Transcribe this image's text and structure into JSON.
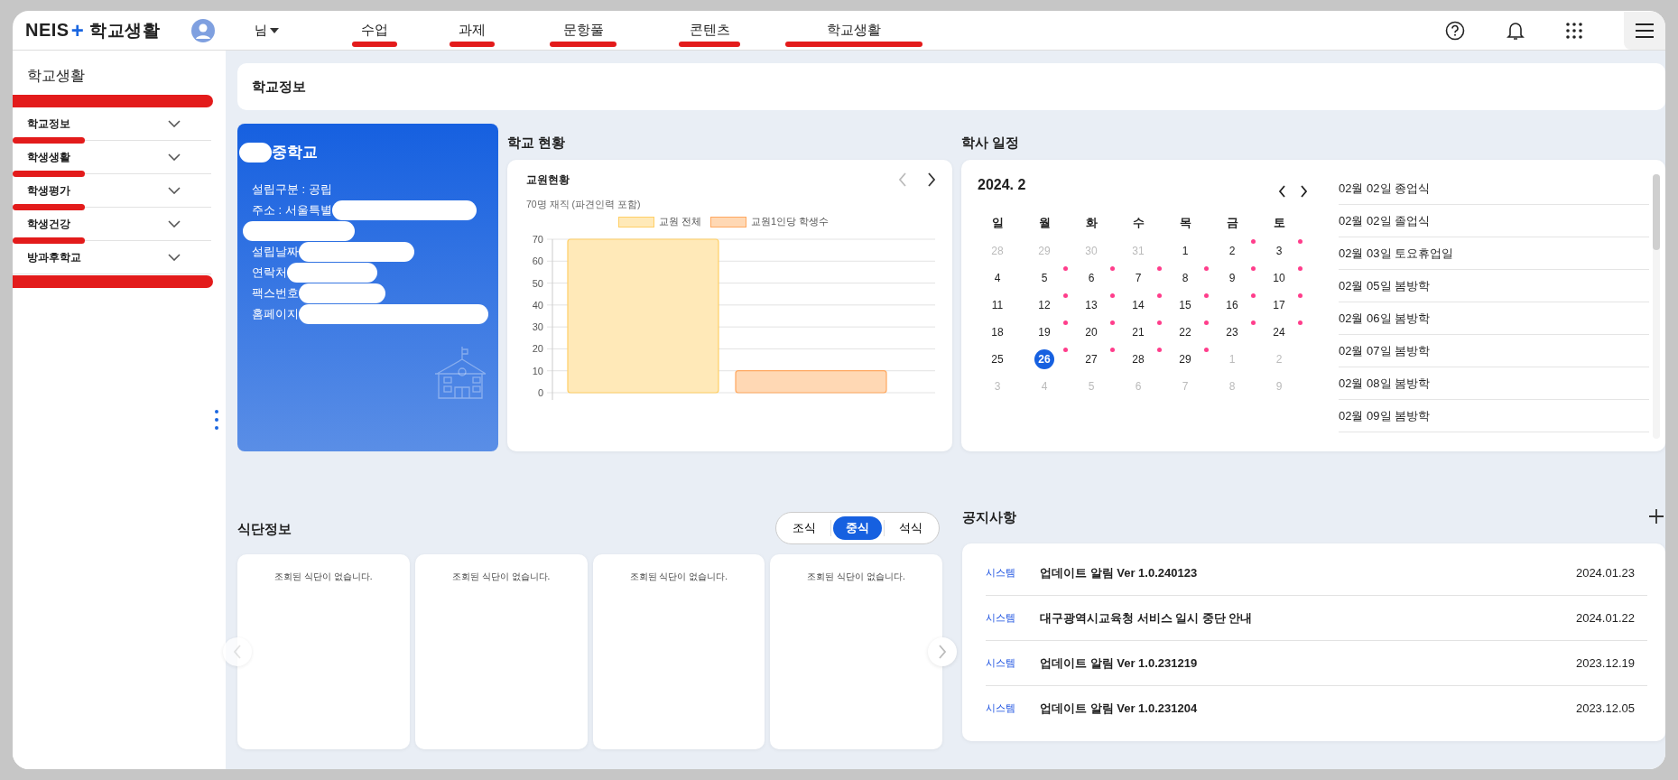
{
  "header": {
    "logo": {
      "text": "NEIS",
      "plus": "+",
      "app": "학교생활"
    },
    "user": {
      "name": "님"
    },
    "nav": [
      {
        "label": "수업",
        "marked": true
      },
      {
        "label": "과제",
        "marked": true
      },
      {
        "label": "문항풀",
        "marked": true
      },
      {
        "label": "콘텐츠",
        "marked": true
      },
      {
        "label": "학교생활",
        "marked": true
      }
    ]
  },
  "sidebar": {
    "title": "학교생활",
    "title_marked": true,
    "items": [
      {
        "label": "학교정보",
        "marked": true,
        "mark_wide": false,
        "expanded": false
      },
      {
        "label": "학생생활",
        "marked": true,
        "mark_wide": false,
        "expanded": false
      },
      {
        "label": "학생평가",
        "marked": true,
        "mark_wide": false,
        "expanded": false
      },
      {
        "label": "학생건강",
        "marked": true,
        "mark_wide": false,
        "expanded": false
      },
      {
        "label": "방과후학교",
        "marked": true,
        "mark_wide": true,
        "expanded": false
      }
    ]
  },
  "page_title": "학교정보",
  "school": {
    "name": "중학교",
    "name_redacted": true,
    "fields": [
      {
        "text": "설립구분 : 공립",
        "redacted": false,
        "redaction_wraps": false
      },
      {
        "text": "주소 : 서울특별",
        "redacted": true,
        "redaction_wraps": true
      },
      {
        "text": "설립날짜",
        "redacted": true,
        "redaction_wraps": false
      },
      {
        "text": "연락처",
        "redacted": true,
        "redaction_wraps": false
      },
      {
        "text": "팩스번호",
        "redacted": true,
        "redaction_wraps": false
      },
      {
        "text": "홈페이지",
        "redacted": true,
        "redaction_wraps": false
      }
    ]
  },
  "status": {
    "heading": "학교 현황",
    "card_title": "교원현황",
    "subtitle": "70명 재직 (파견인력 포함)",
    "chart_data": {
      "type": "bar",
      "grid": true,
      "series": [
        {
          "name": "교원 전체",
          "color": "#ffe9b8",
          "values": [
            70
          ]
        },
        {
          "name": "교원1인당 학생수",
          "color": "#ffd8b4",
          "values": [
            10
          ]
        }
      ],
      "ylim": [
        0,
        70
      ],
      "yticks": [
        0,
        10,
        20,
        30,
        40,
        50,
        60,
        70
      ]
    }
  },
  "schedule": {
    "heading": "학사 일정",
    "month": "2024. 2",
    "weekdays": [
      "일",
      "월",
      "화",
      "수",
      "목",
      "금",
      "토"
    ],
    "weeks": [
      [
        {
          "day": "28",
          "muted": true,
          "event": false,
          "selected": false
        },
        {
          "day": "29",
          "muted": true,
          "event": false,
          "selected": false
        },
        {
          "day": "30",
          "muted": true,
          "event": false,
          "selected": false
        },
        {
          "day": "31",
          "muted": true,
          "event": false,
          "selected": false
        },
        {
          "day": "1",
          "muted": false,
          "event": false,
          "selected": false
        },
        {
          "day": "2",
          "muted": false,
          "event": true,
          "selected": false
        },
        {
          "day": "3",
          "muted": false,
          "event": true,
          "selected": false
        }
      ],
      [
        {
          "day": "4",
          "muted": false,
          "event": false,
          "selected": false
        },
        {
          "day": "5",
          "muted": false,
          "event": true,
          "selected": false
        },
        {
          "day": "6",
          "muted": false,
          "event": true,
          "selected": false
        },
        {
          "day": "7",
          "muted": false,
          "event": true,
          "selected": false
        },
        {
          "day": "8",
          "muted": false,
          "event": true,
          "selected": false
        },
        {
          "day": "9",
          "muted": false,
          "event": true,
          "selected": false
        },
        {
          "day": "10",
          "muted": false,
          "event": true,
          "selected": false
        }
      ],
      [
        {
          "day": "11",
          "muted": false,
          "event": false,
          "selected": false
        },
        {
          "day": "12",
          "muted": false,
          "event": true,
          "selected": false
        },
        {
          "day": "13",
          "muted": false,
          "event": true,
          "selected": false
        },
        {
          "day": "14",
          "muted": false,
          "event": true,
          "selected": false
        },
        {
          "day": "15",
          "muted": false,
          "event": true,
          "selected": false
        },
        {
          "day": "16",
          "muted": false,
          "event": true,
          "selected": false
        },
        {
          "day": "17",
          "muted": false,
          "event": true,
          "selected": false
        }
      ],
      [
        {
          "day": "18",
          "muted": false,
          "event": false,
          "selected": false
        },
        {
          "day": "19",
          "muted": false,
          "event": true,
          "selected": false
        },
        {
          "day": "20",
          "muted": false,
          "event": true,
          "selected": false
        },
        {
          "day": "21",
          "muted": false,
          "event": true,
          "selected": false
        },
        {
          "day": "22",
          "muted": false,
          "event": true,
          "selected": false
        },
        {
          "day": "23",
          "muted": false,
          "event": true,
          "selected": false
        },
        {
          "day": "24",
          "muted": false,
          "event": true,
          "selected": false
        }
      ],
      [
        {
          "day": "25",
          "muted": false,
          "event": false,
          "selected": false
        },
        {
          "day": "26",
          "muted": false,
          "event": true,
          "selected": true
        },
        {
          "day": "27",
          "muted": false,
          "event": true,
          "selected": false
        },
        {
          "day": "28",
          "muted": false,
          "event": true,
          "selected": false
        },
        {
          "day": "29",
          "muted": false,
          "event": true,
          "selected": false
        },
        {
          "day": "1",
          "muted": true,
          "event": false,
          "selected": false
        },
        {
          "day": "2",
          "muted": true,
          "event": false,
          "selected": false
        }
      ],
      [
        {
          "day": "3",
          "muted": true,
          "event": false,
          "selected": false
        },
        {
          "day": "4",
          "muted": true,
          "event": false,
          "selected": false
        },
        {
          "day": "5",
          "muted": true,
          "event": false,
          "selected": false
        },
        {
          "day": "6",
          "muted": true,
          "event": false,
          "selected": false
        },
        {
          "day": "7",
          "muted": true,
          "event": false,
          "selected": false
        },
        {
          "day": "8",
          "muted": true,
          "event": false,
          "selected": false
        },
        {
          "day": "9",
          "muted": true,
          "event": false,
          "selected": false
        }
      ]
    ],
    "events": [
      "02월 02일 종업식",
      "02월 02일 졸업식",
      "02월 03일 토요휴업일",
      "02월 05일 봄방학",
      "02월 06일 봄방학",
      "02월 07일 봄방학",
      "02월 08일 봄방학",
      "02월 09일 봄방학"
    ]
  },
  "meals": {
    "heading": "식단정보",
    "tabs": [
      {
        "label": "조식",
        "selected": false
      },
      {
        "label": "중식",
        "selected": true
      },
      {
        "label": "석식",
        "selected": false
      }
    ],
    "cards": [
      "조회된 식단이 없습니다.",
      "조회된 식단이 없습니다.",
      "조회된 식단이 없습니다.",
      "조회된 식단이 없습니다."
    ]
  },
  "notices": {
    "heading": "공지사항",
    "rows": [
      {
        "category": "시스템",
        "title": "업데이트 알림 Ver 1.0.240123",
        "date": "2024.01.23"
      },
      {
        "category": "시스템",
        "title": "대구광역시교육청 서비스 일시 중단 안내",
        "date": "2024.01.22"
      },
      {
        "category": "시스템",
        "title": "업데이트 알림 Ver 1.0.231219",
        "date": "2023.12.19"
      },
      {
        "category": "시스템",
        "title": "업데이트 알림 Ver 1.0.231204",
        "date": "2023.12.05"
      }
    ]
  }
}
